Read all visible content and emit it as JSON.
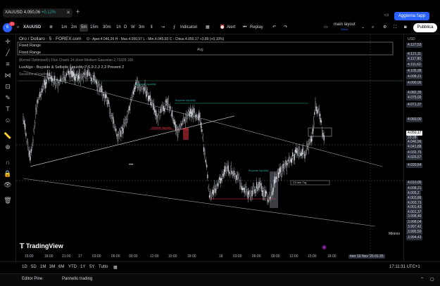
{
  "tab": {
    "title": "XAUUSD",
    "price": "4.050,06",
    "change": "+0.12%"
  },
  "upgrade_label": "Aggiorna l'app",
  "toolbar": {
    "symbol": "XAUUSD",
    "timeframes": [
      "1m",
      "2m",
      "5m",
      "15m",
      "30m",
      "1h",
      "D",
      "W",
      "3m"
    ],
    "active_timeframe": "5m",
    "indicators_label": "Indicatori",
    "alert_label": "Alert",
    "replay_label": "Replay",
    "layout_label": "main layout",
    "layout_sub": "Salva",
    "publish_label": "Pubblica"
  },
  "legend": {
    "symbol_line": "Oro / Dollaro · 5 · FOREX.com",
    "ohlc": "O - Aper.4.046,26  H - Max.4.050,57  L - Min.4.045,93  C - Chius.4.050,17  +3,89 (+0,10%)",
    "row1": "Fixed Range",
    "row2": "Fixed Range",
    "row3": "(Kernel Optimized) | Flux Charts 14 close Medium Gaussian 2,71828 100",
    "row4": "LuxAlgo - Buyside & Sellside Liquidity  7 6,9 2,3 2,3 Present 2",
    "row5": "Sessions of trading"
  },
  "annotations": {
    "avg_label": "Avg",
    "bullish_liq": "Buyside liquidity",
    "sellside_liq": "Sellside liquidity",
    "fvg_label": "Cli mm Trg",
    "dots": "•••"
  },
  "price_axis": {
    "labels": [
      "USD",
      "4.127,53",
      "4.121,11",
      "4.117,80",
      "4.111,62",
      "4.105,98",
      "4.098,21",
      "4.090,00",
      "4.082,35",
      "4.075,00",
      "4.071,37",
      "4.060,00",
      "4.050,17",
      "23:28",
      "4.046,96",
      "4.041,88",
      "4.032,75",
      "4.026,57",
      "4.020,64",
      "4.010,05",
      "4.008,21",
      "4.005,2",
      "4.003,86",
      "4.003,73",
      "4.001,43",
      "4.001,37",
      "3.998,46",
      "3.998,04",
      "3.997,42",
      "3.995,50",
      "3.994,43"
    ],
    "current_index": 12,
    "minimo_label": "Minimo"
  },
  "time_axis": [
    "15:00",
    "18:00",
    "21:00",
    "17",
    "03:00",
    "06:00",
    "09:00",
    "12:00",
    "15:00",
    "18:00",
    "18",
    "03:00",
    "06:00",
    "09:00",
    "12:00",
    "15:00",
    "18:00"
  ],
  "time_cursor": "mer 19 Nov '25  01:25",
  "range_bar": {
    "ranges": [
      "1D",
      "5D",
      "1M",
      "3M",
      "6M",
      "YTD",
      "1Y",
      "5Y",
      "Tutto"
    ],
    "clock": "17:11:31 UTC+1"
  },
  "bottom_bar": {
    "pine": "Editor Pine",
    "trading": "Pannello trading"
  },
  "brand": "TradingView",
  "colors": {
    "accent": "#2962ff",
    "bull": "#26a69a",
    "bear": "#f23645",
    "candle": "#d1d4dc"
  }
}
